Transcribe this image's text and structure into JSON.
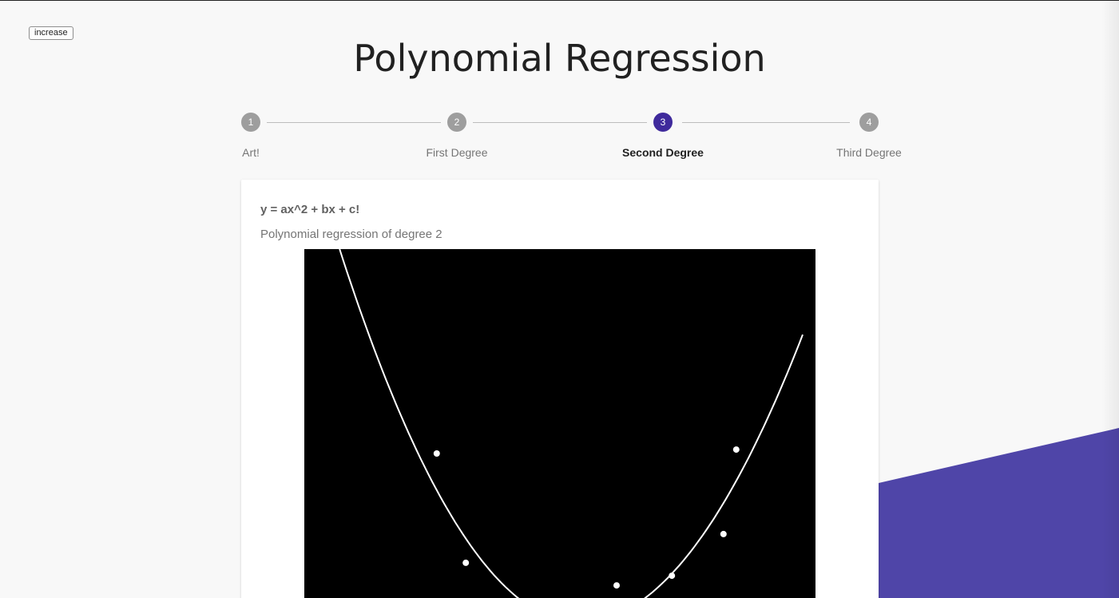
{
  "toolbar": {
    "increase_label": "increase"
  },
  "header": {
    "title": "Polynomial Regression"
  },
  "stepper": {
    "steps": [
      {
        "number": "1",
        "label": "Art!"
      },
      {
        "number": "2",
        "label": "First Degree"
      },
      {
        "number": "3",
        "label": "Second Degree",
        "active": true
      },
      {
        "number": "4",
        "label": "Third Degree"
      }
    ]
  },
  "card": {
    "title": "y = ax^2 + bx + c!",
    "subtitle": "Polynomial regression of degree 2"
  },
  "colors": {
    "accent": "#3f2a9c",
    "purple_shape": "#4f45a8",
    "canvas_bg": "#000000",
    "curve": "#ffffff",
    "points": "#ffffff"
  },
  "plot": {
    "points": [
      {
        "x": 0.259,
        "y": 0.569
      },
      {
        "x": 0.316,
        "y": 0.873
      },
      {
        "x": 0.611,
        "y": 0.936
      },
      {
        "x": 0.719,
        "y": 0.909
      },
      {
        "x": 0.82,
        "y": 0.793
      },
      {
        "x": 0.845,
        "y": 0.558
      }
    ],
    "curve": [
      {
        "x": 0.069,
        "y": 0.0
      },
      {
        "x": 0.975,
        "y": 0.238
      }
    ]
  }
}
